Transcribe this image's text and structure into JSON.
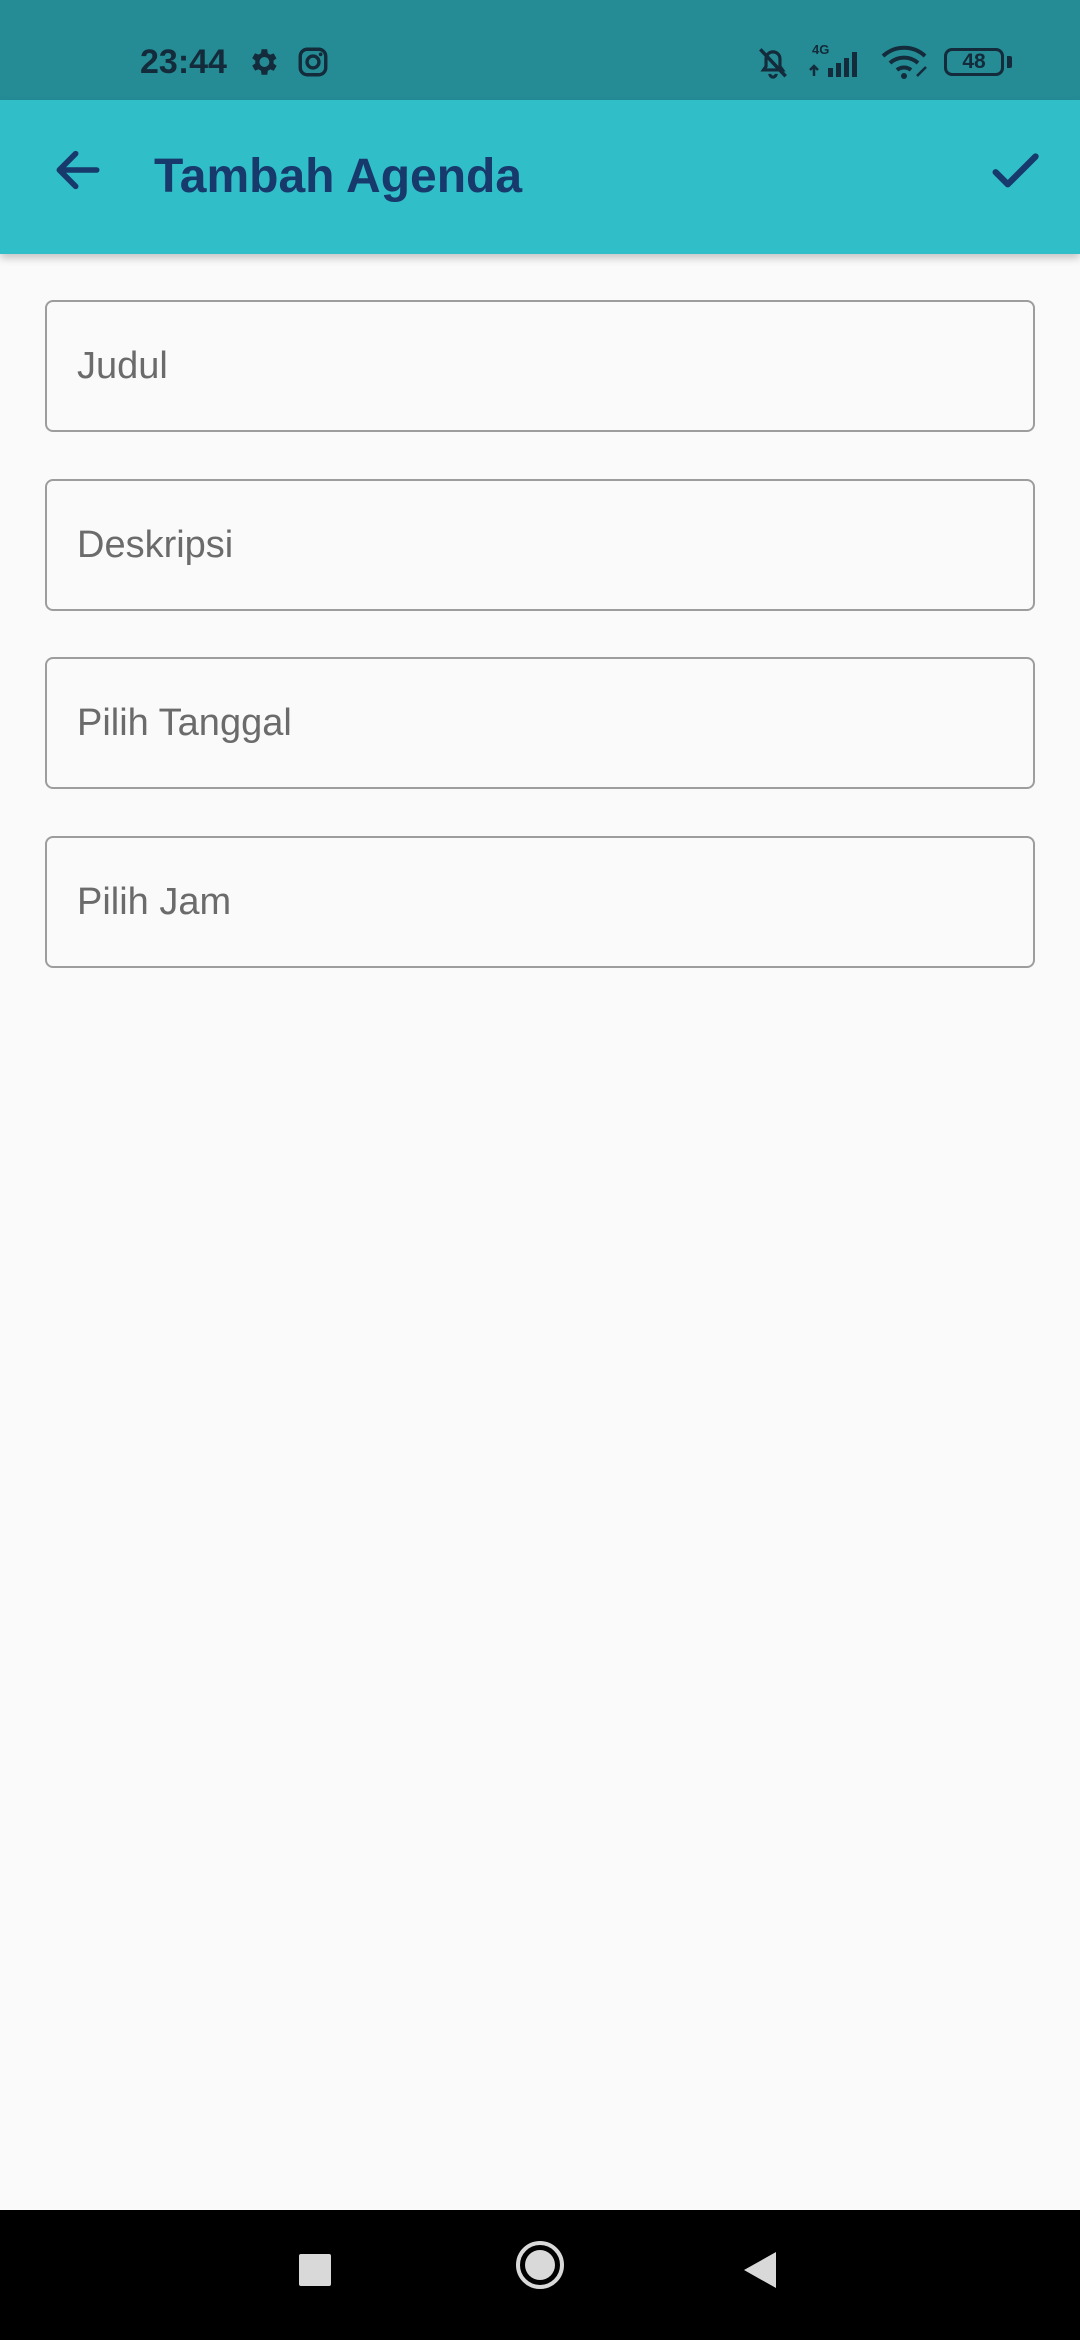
{
  "status_bar": {
    "time": "23:44",
    "network_label": "4G",
    "battery_level": "48",
    "icons": [
      "settings-icon",
      "instagram-icon",
      "notifications-off-icon",
      "signal-icon",
      "wifi-icon",
      "battery-icon"
    ]
  },
  "app_bar": {
    "title": "Tambah Agenda",
    "back_icon": "arrow-left-icon",
    "save_icon": "check-icon",
    "background": "#30bec8",
    "title_color": "#17396b"
  },
  "form": {
    "title_placeholder": "Judul",
    "description_placeholder": "Deskripsi",
    "date_placeholder": "Pilih Tanggal",
    "time_placeholder": "Pilih Jam"
  },
  "nav_bar": {
    "icons": [
      "recents-icon",
      "home-icon",
      "back-icon"
    ]
  }
}
